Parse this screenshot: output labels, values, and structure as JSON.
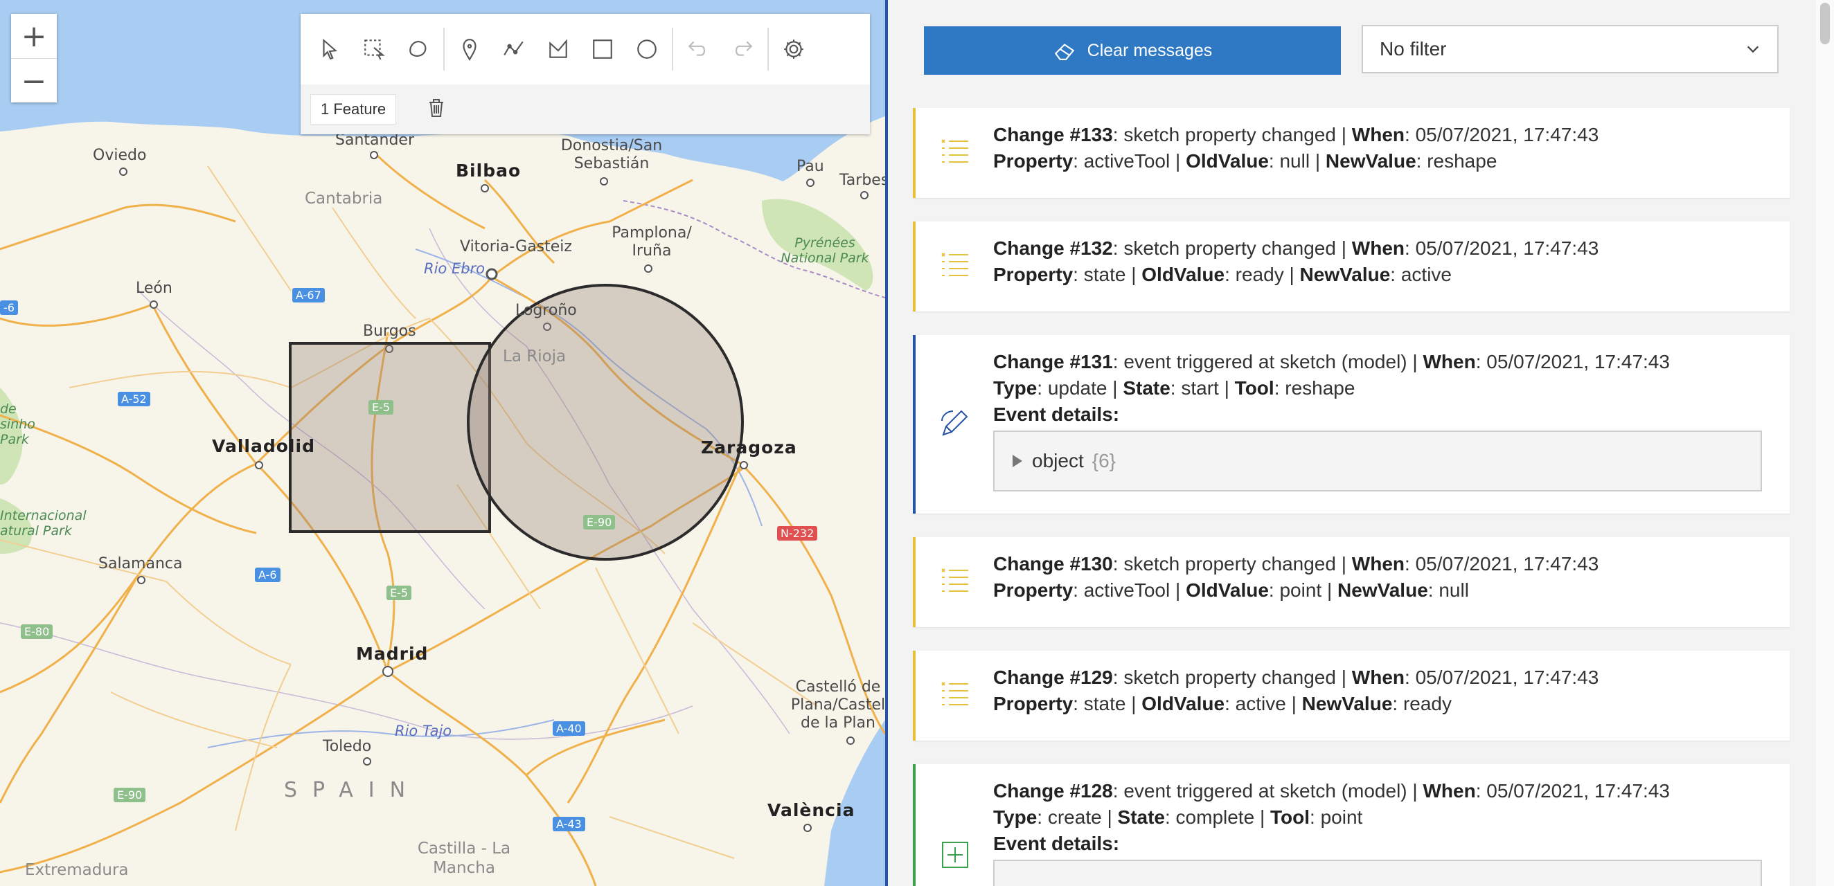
{
  "map": {
    "zoom_in_label": "+",
    "zoom_out_label": "−",
    "labels": {
      "oviedo": "Oviedo",
      "santander": "Santander",
      "bilbao": "Bilbao",
      "donostia": "Donostia/San Sebastián",
      "pau": "Pau",
      "tarbes": "Tarbes",
      "cantabria": "Cantabria",
      "vitoria": "Vitoria-Gasteiz",
      "pamplona": "Pamplona/ Iruña",
      "pyrenees": "Pyrénées National Park",
      "leon": "León",
      "rio_ebro": "Rio Ebro",
      "logrono": "Logroño",
      "burgos": "Burgos",
      "la_rioja": "La Rioja",
      "valladolid": "Valladolid",
      "zaragoza": "Zaragoza",
      "salamanca": "Salamanca",
      "internacional": "Internacional atural Park",
      "sinho": "sinho Park",
      "madrid": "Madrid",
      "castello": "Castelló de Plana/Castel de la Plan",
      "rio_tajo": "Rio Tajo",
      "toledo": "Toledo",
      "spain": "SPAIN",
      "valencia": "València",
      "castilla": "Castilla - La Mancha",
      "extremadura": "Extremadura",
      "de": "de"
    },
    "shields": {
      "a67": "A-67",
      "a52": "A-52",
      "e5a": "E-5",
      "e5b": "E-5",
      "e90a": "E-90",
      "n232": "N-232",
      "a6": "A-6",
      "e80": "E-80",
      "a40": "A-40",
      "e90b": "E-90",
      "a43": "A-43",
      "edge6": "-6"
    }
  },
  "sketch": {
    "tools": [
      "select-icon",
      "rectangle-select-icon",
      "lasso-select-icon",
      "point-icon",
      "polyline-icon",
      "polygon-icon",
      "rectangle-icon",
      "circle-icon",
      "undo-icon",
      "redo-icon",
      "settings-icon"
    ],
    "feature_count": "1 Feature"
  },
  "panel": {
    "clear_label": "Clear messages",
    "filter_value": "No filter",
    "colors": {
      "property": "#e6c13a",
      "event": "#2553a6",
      "create": "#3aa04c",
      "button": "#2f78c4"
    },
    "cards": [
      {
        "num": "Change #133",
        "kind": "sketch property changed",
        "when": "05/07/2021, 17:47:43",
        "l2": [
          [
            "Property",
            "activeTool"
          ],
          [
            "OldValue",
            "null"
          ],
          [
            "NewValue",
            "reshape"
          ]
        ]
      },
      {
        "num": "Change #132",
        "kind": "sketch property changed",
        "when": "05/07/2021, 17:47:43",
        "l2": [
          [
            "Property",
            "state"
          ],
          [
            "OldValue",
            "ready"
          ],
          [
            "NewValue",
            "active"
          ]
        ]
      },
      {
        "num": "Change #131",
        "kind": "event triggered at sketch (model)",
        "when": "05/07/2021, 17:47:43",
        "l2": [
          [
            "Type",
            "update"
          ],
          [
            "State",
            "start"
          ],
          [
            "Tool",
            "reshape"
          ]
        ],
        "details_label": "Event details:",
        "object": "object",
        "count": "{6}"
      },
      {
        "num": "Change #130",
        "kind": "sketch property changed",
        "when": "05/07/2021, 17:47:43",
        "l2": [
          [
            "Property",
            "activeTool"
          ],
          [
            "OldValue",
            "point"
          ],
          [
            "NewValue",
            "null"
          ]
        ]
      },
      {
        "num": "Change #129",
        "kind": "sketch property changed",
        "when": "05/07/2021, 17:47:43",
        "l2": [
          [
            "Property",
            "state"
          ],
          [
            "OldValue",
            "active"
          ],
          [
            "NewValue",
            "ready"
          ]
        ]
      },
      {
        "num": "Change #128",
        "kind": "event triggered at sketch (model)",
        "when": "05/07/2021, 17:47:43",
        "l2": [
          [
            "Type",
            "create"
          ],
          [
            "State",
            "complete"
          ],
          [
            "Tool",
            "point"
          ]
        ],
        "details_label": "Event details:"
      }
    ],
    "when_label": "When"
  }
}
